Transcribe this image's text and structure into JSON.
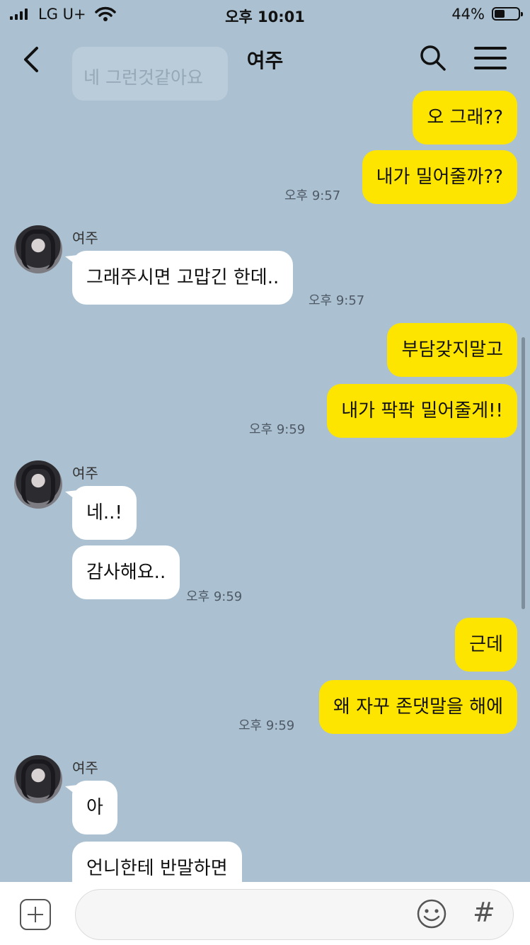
{
  "status": {
    "carrier": "LG U+",
    "time": "오후 10:01",
    "battery": "44%",
    "battery_level": 0.44
  },
  "header": {
    "title": "여주",
    "ghost_text": "네 그런것같아요"
  },
  "messages": {
    "m1": "오 그래??",
    "m2": "내가 밀어줄까??",
    "t1": "오후 9:57",
    "n1": "여주",
    "m3": "그래주시면 고맙긴 한데..",
    "t2": "오후 9:57",
    "m4": "부담갖지말고",
    "m5": "내가 팍팍 밀어줄게!!",
    "t3": "오후 9:59",
    "n2": "여주",
    "m6": "네..!",
    "m7": "감사해요..",
    "t4": "오후 9:59",
    "m8": "근데",
    "m9": "왜 자꾸 존댓말을 해에",
    "t5": "오후 9:59",
    "n3": "여주",
    "m10": "아",
    "m11": "언니한테 반말하면"
  },
  "input": {
    "placeholder": ""
  },
  "colors": {
    "background": "#abc1d1",
    "my_bubble": "#fee500",
    "their_bubble": "#ffffff"
  },
  "icons": [
    "back-icon",
    "search-icon",
    "menu-icon",
    "plus-icon",
    "emoji-icon",
    "hash-icon"
  ]
}
